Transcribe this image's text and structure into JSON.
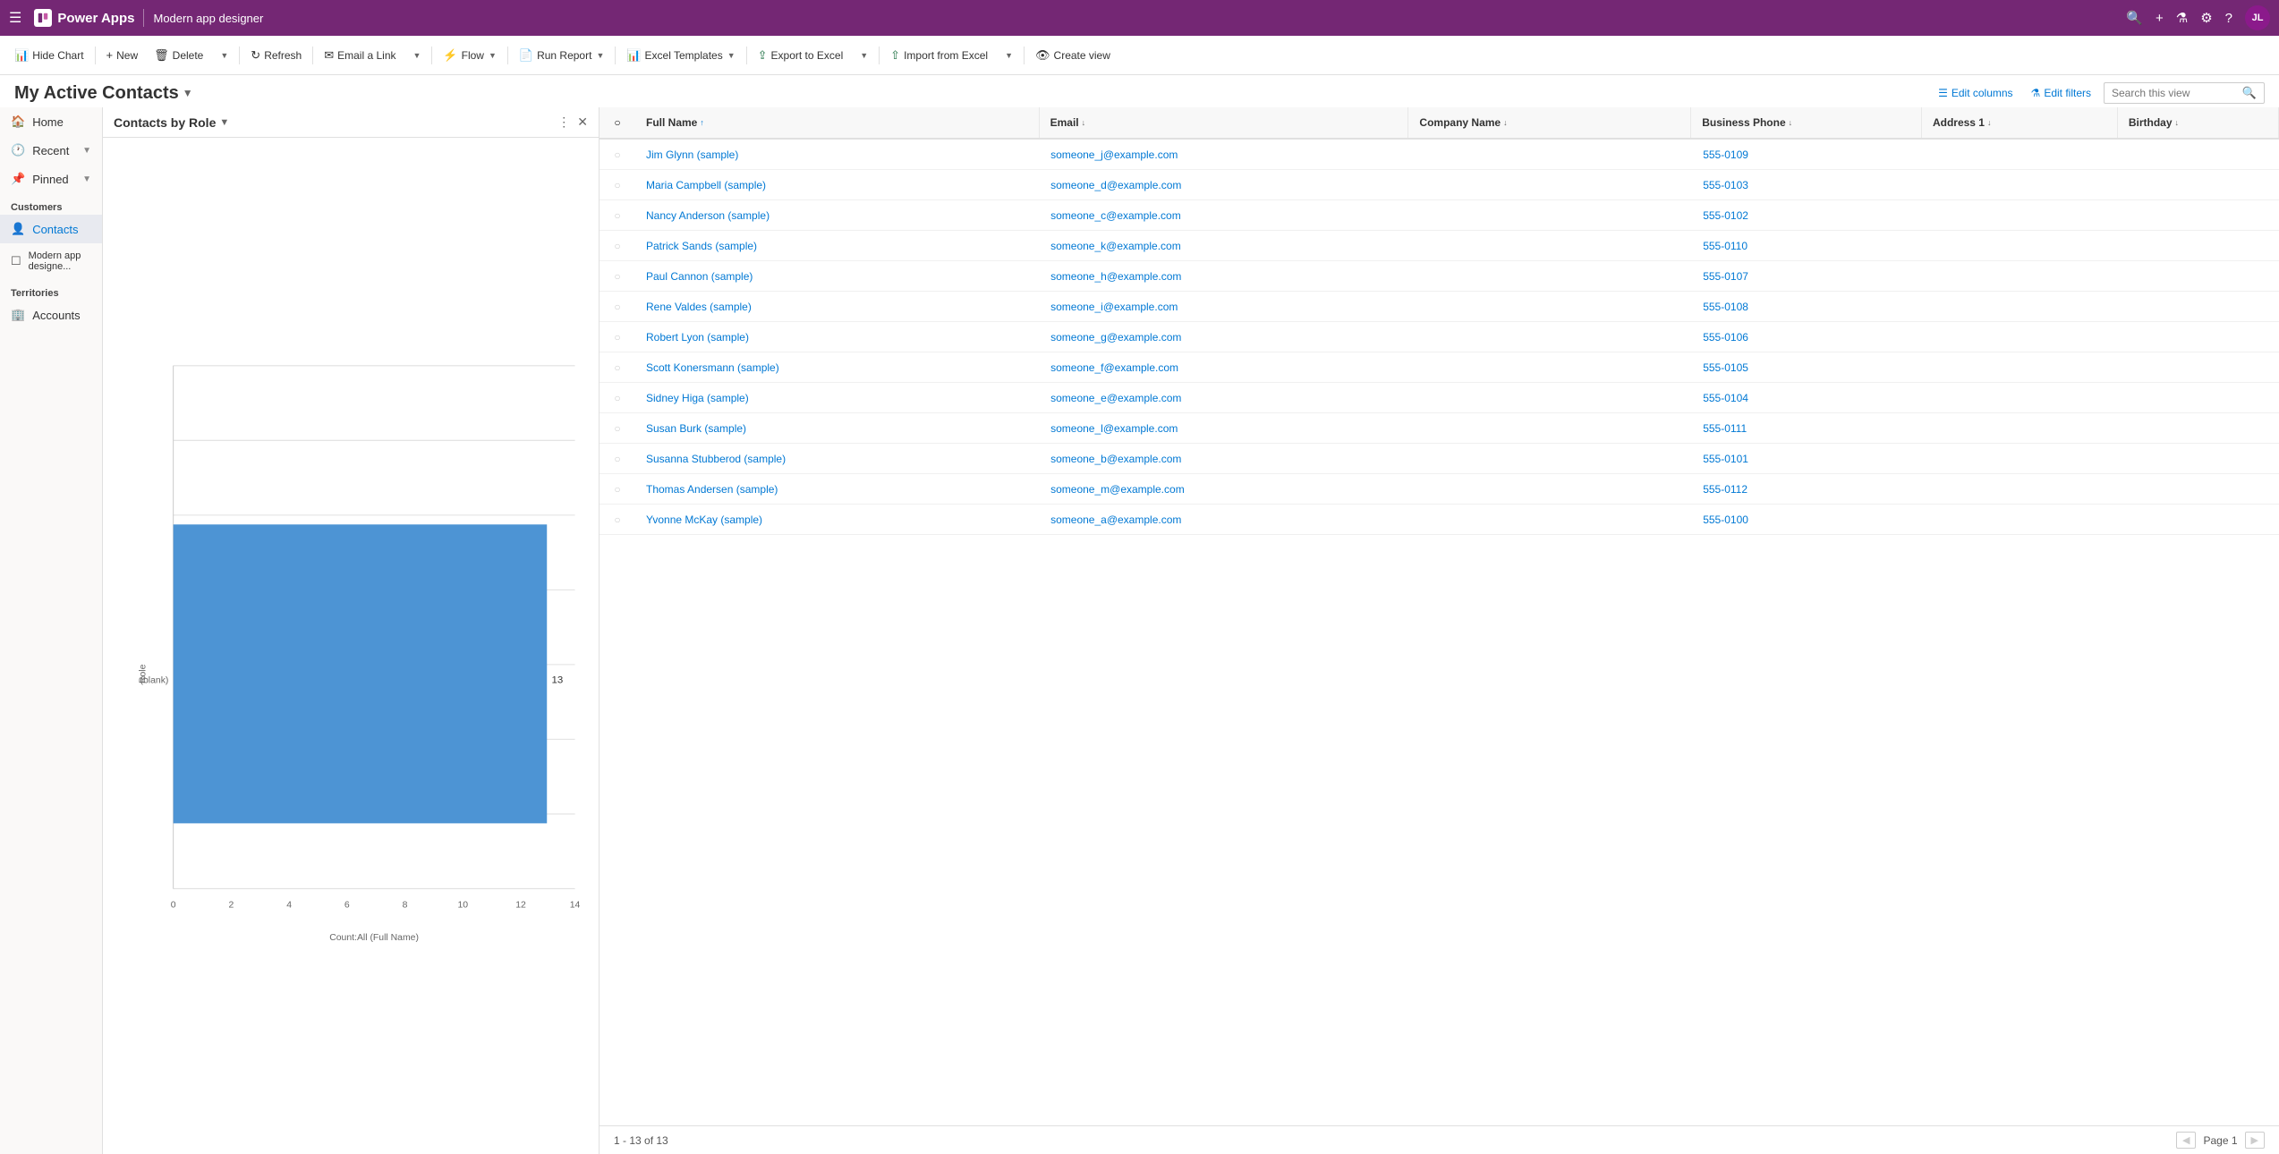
{
  "topnav": {
    "brand": "Power Apps",
    "app_name": "Modern app designer",
    "avatar_initials": "JL"
  },
  "toolbar": {
    "hide_chart": "Hide Chart",
    "new": "New",
    "delete": "Delete",
    "refresh": "Refresh",
    "email_a_link": "Email a Link",
    "flow": "Flow",
    "run_report": "Run Report",
    "excel_templates": "Excel Templates",
    "export_to_excel": "Export to Excel",
    "import_from_excel": "Import from Excel",
    "create_view": "Create view"
  },
  "view": {
    "title": "My Active Contacts",
    "edit_columns": "Edit columns",
    "edit_filters": "Edit filters",
    "search_placeholder": "Search this view"
  },
  "sidebar": {
    "home": "Home",
    "recent": "Recent",
    "pinned": "Pinned",
    "customers_section": "Customers",
    "contacts": "Contacts",
    "modern_app_designer": "Modern app designe...",
    "territories_section": "Territories",
    "accounts": "Accounts"
  },
  "chart": {
    "title": "Contacts by Role",
    "y_axis_label": "Role",
    "y_blank_label": "(blank)",
    "x_axis_ticks": [
      "0",
      "2",
      "4",
      "6",
      "8",
      "10",
      "12",
      "14"
    ],
    "x_axis_footer": "Count:All (Full Name)",
    "bar_value": "13",
    "bar_height_pct": 72,
    "bar_width_pct": 60
  },
  "table": {
    "columns": [
      {
        "label": "Full Name",
        "sort": "↑",
        "key": "fullname"
      },
      {
        "label": "Email",
        "sort": "↓",
        "key": "email"
      },
      {
        "label": "Company Name",
        "sort": "↓",
        "key": "company"
      },
      {
        "label": "Business Phone",
        "sort": "↓",
        "key": "phone"
      },
      {
        "label": "Address 1",
        "sort": "↓",
        "key": "address"
      },
      {
        "label": "Birthday",
        "sort": "↓",
        "key": "birthday"
      }
    ],
    "rows": [
      {
        "fullname": "Jim Glynn (sample)",
        "email": "someone_j@example.com",
        "company": "",
        "phone": "555-0109",
        "address": "",
        "birthday": ""
      },
      {
        "fullname": "Maria Campbell (sample)",
        "email": "someone_d@example.com",
        "company": "",
        "phone": "555-0103",
        "address": "",
        "birthday": ""
      },
      {
        "fullname": "Nancy Anderson (sample)",
        "email": "someone_c@example.com",
        "company": "",
        "phone": "555-0102",
        "address": "",
        "birthday": ""
      },
      {
        "fullname": "Patrick Sands (sample)",
        "email": "someone_k@example.com",
        "company": "",
        "phone": "555-0110",
        "address": "",
        "birthday": ""
      },
      {
        "fullname": "Paul Cannon (sample)",
        "email": "someone_h@example.com",
        "company": "",
        "phone": "555-0107",
        "address": "",
        "birthday": ""
      },
      {
        "fullname": "Rene Valdes (sample)",
        "email": "someone_i@example.com",
        "company": "",
        "phone": "555-0108",
        "address": "",
        "birthday": ""
      },
      {
        "fullname": "Robert Lyon (sample)",
        "email": "someone_g@example.com",
        "company": "",
        "phone": "555-0106",
        "address": "",
        "birthday": ""
      },
      {
        "fullname": "Scott Konersmann (sample)",
        "email": "someone_f@example.com",
        "company": "",
        "phone": "555-0105",
        "address": "",
        "birthday": ""
      },
      {
        "fullname": "Sidney Higa (sample)",
        "email": "someone_e@example.com",
        "company": "",
        "phone": "555-0104",
        "address": "",
        "birthday": ""
      },
      {
        "fullname": "Susan Burk (sample)",
        "email": "someone_l@example.com",
        "company": "",
        "phone": "555-0111",
        "address": "",
        "birthday": ""
      },
      {
        "fullname": "Susanna Stubberod (sample)",
        "email": "someone_b@example.com",
        "company": "",
        "phone": "555-0101",
        "address": "",
        "birthday": ""
      },
      {
        "fullname": "Thomas Andersen (sample)",
        "email": "someone_m@example.com",
        "company": "",
        "phone": "555-0112",
        "address": "",
        "birthday": ""
      },
      {
        "fullname": "Yvonne McKay (sample)",
        "email": "someone_a@example.com",
        "company": "",
        "phone": "555-0100",
        "address": "",
        "birthday": ""
      }
    ],
    "footer_range": "1 - 13 of 13",
    "page_label": "Page 1"
  }
}
